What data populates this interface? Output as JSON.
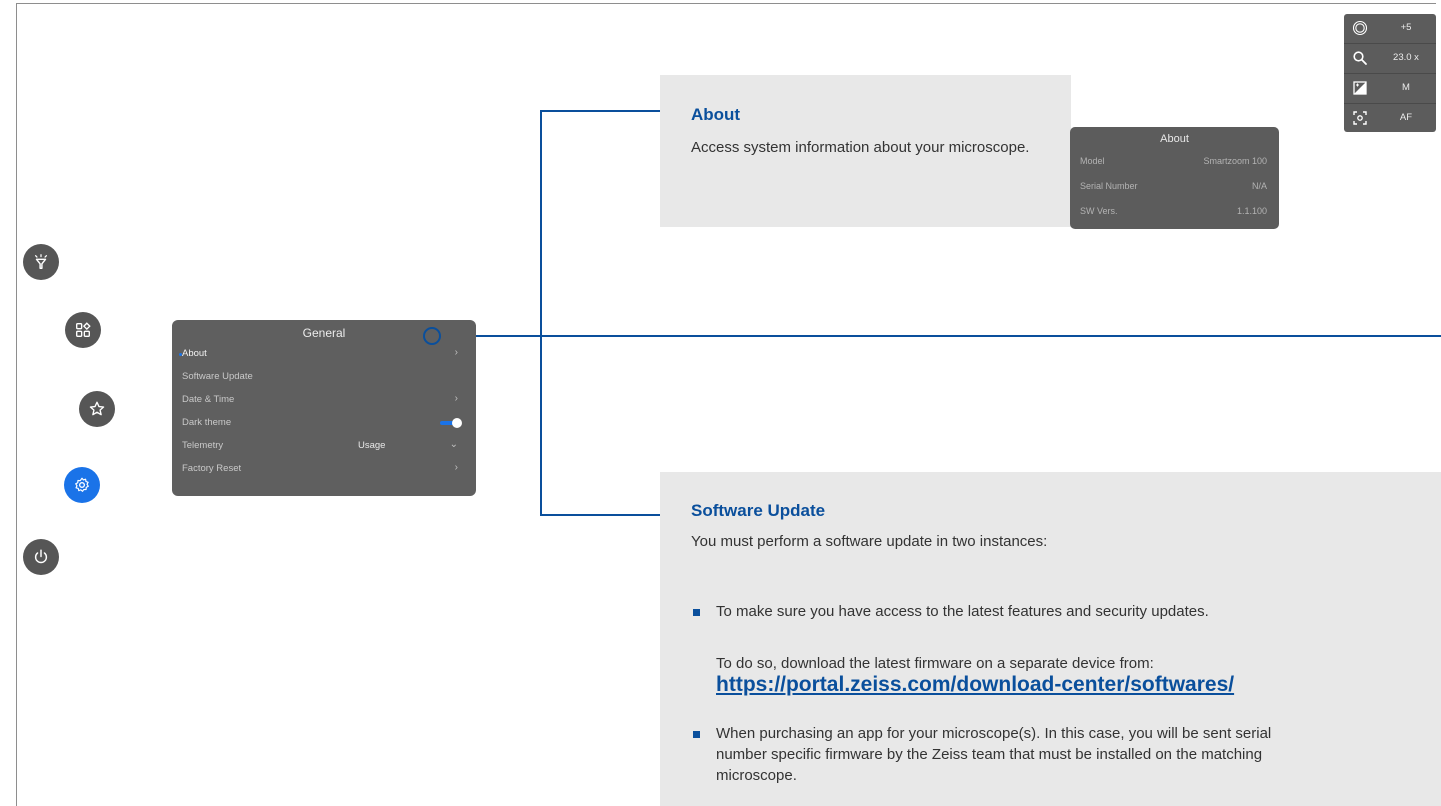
{
  "side_buttons": [
    {
      "icon": "lamp-icon"
    },
    {
      "icon": "apps-icon"
    },
    {
      "icon": "star-icon"
    },
    {
      "icon": "settings-icon",
      "active": true
    },
    {
      "icon": "power-icon"
    }
  ],
  "menu": {
    "title": "General",
    "items": [
      {
        "label": "About",
        "selected": true
      },
      {
        "label": "Software Update"
      },
      {
        "label": "Date & Time"
      },
      {
        "label": "Dark theme",
        "toggle_on": true
      },
      {
        "label": "Telemetry",
        "value": "Usage"
      },
      {
        "label": "Factory Reset"
      }
    ]
  },
  "about_callout": {
    "title": "About",
    "text": "Access system information about your microscope."
  },
  "about_card": {
    "title": "About",
    "rows": [
      {
        "key": "Model",
        "value": "Smartzoom 100"
      },
      {
        "key": "Serial Number",
        "value": "N/A"
      },
      {
        "key": "SW Vers.",
        "value": "1.1.100"
      }
    ]
  },
  "status_panel": [
    {
      "icon": "illumination-icon",
      "value": "+5"
    },
    {
      "icon": "zoom-icon",
      "value": "23.0 x"
    },
    {
      "icon": "exposure-icon",
      "value": "M"
    },
    {
      "icon": "autofocus-icon",
      "value": "AF"
    }
  ],
  "software_update_callout": {
    "title": "Software Update",
    "intro": "You must perform a software update in two instances:",
    "bullet1": "To make sure you have access to the latest features and security updates.",
    "bullet1_note": "To do so, download the latest firmware on a separate device from:",
    "link": "https://portal.zeiss.com/download-center/softwares/",
    "bullet2": "When purchasing an app for your microscope(s). In this case, you will be sent serial number specific firmware by the Zeiss team that must be installed on the matching microscope."
  },
  "colors": {
    "accent": "#0a4f9c",
    "active_button": "#1a73e8",
    "panel": "#5f5f5f",
    "callout_bg": "#e8e8e8"
  }
}
